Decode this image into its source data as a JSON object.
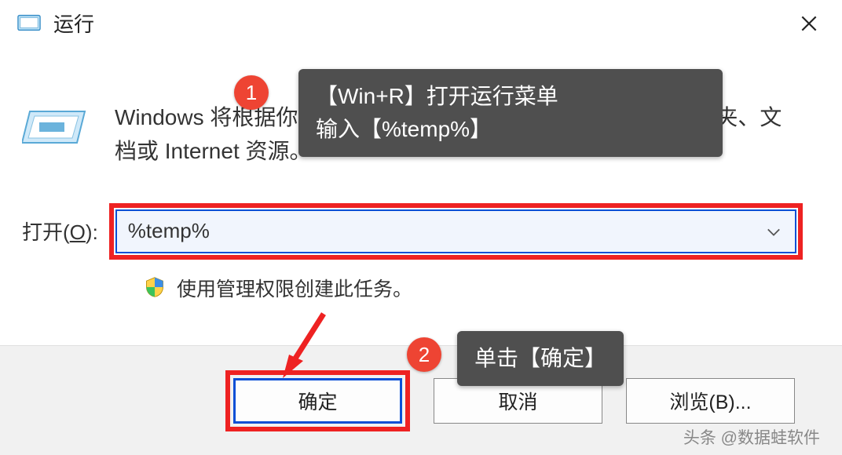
{
  "titlebar": {
    "title": "运行"
  },
  "content": {
    "description": "Windows 将根据你所输入的名称，为你打开相应的程序、文件夹、文档或 Internet 资源。",
    "open_label_prefix": "打开(",
    "open_label_key": "O",
    "open_label_suffix": "):",
    "open_value": "%temp%",
    "admin_text": "使用管理权限创建此任务。"
  },
  "buttons": {
    "ok": "确定",
    "cancel": "取消",
    "browse": "浏览(B)..."
  },
  "annotations": {
    "badge1": "1",
    "tooltip1_line1": "【Win+R】打开运行菜单",
    "tooltip1_line2": "输入【%temp%】",
    "badge2": "2",
    "tooltip2": "单击【确定】"
  },
  "watermark": "头条 @数据蛙软件"
}
